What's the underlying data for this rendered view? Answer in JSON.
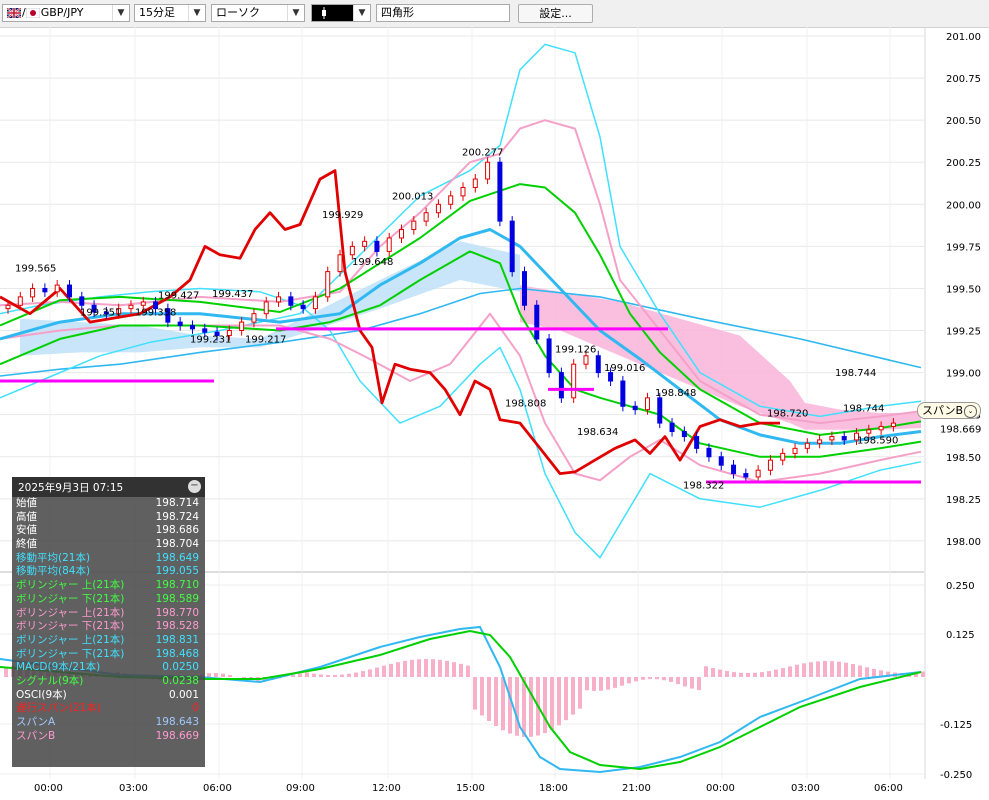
{
  "toolbar": {
    "symbol": "GBP/JPY",
    "symbol_prefix": "/",
    "timeframe": "15分足",
    "chart_type": "ローソク",
    "drawing_tool_icon": "candlestick-icon",
    "shape": "四角形",
    "settings_label": "設定..."
  },
  "colors": {
    "bull": "#e00000",
    "bear": "#0000e0",
    "ma21": "#00d000",
    "ma84": "#30b8f0",
    "bb_pink": "#f5a0c8",
    "bb_cyan": "#40e0ff",
    "chikou": "#e00000",
    "kumo": "#f9b4d8",
    "hline": "#ff00ff"
  },
  "price_axis": [
    "201.00",
    "200.75",
    "200.50",
    "200.25",
    "200.00",
    "199.75",
    "199.50",
    "199.25",
    "199.00",
    "198.75",
    "198.50",
    "198.25",
    "198.00"
  ],
  "macd_axis": [
    "0.250",
    "0.125",
    "-0.125",
    "-0.250"
  ],
  "current_price": "198.669",
  "spanb_tag": "スパンB",
  "time_axis": [
    "00:00",
    "03:00",
    "06:00",
    "09:00",
    "12:00",
    "15:00",
    "18:00",
    "21:00",
    "00:00",
    "03:00",
    "06:00"
  ],
  "annotations": [
    "199.565",
    "199.427",
    "199.437",
    "199.351",
    "199.358",
    "199.231",
    "199.217",
    "199.929",
    "199.648",
    "200.013",
    "200.277",
    "199.126",
    "199.016",
    "198.808",
    "198.848",
    "198.634",
    "198.322",
    "198.720",
    "198.744",
    "198.744",
    "198.590"
  ],
  "info_panel": {
    "datetime": "2025年9月3日  07:15",
    "rows": [
      {
        "label": "始値",
        "value": "198.714",
        "color": "#ffffff"
      },
      {
        "label": "高値",
        "value": "198.724",
        "color": "#ffffff"
      },
      {
        "label": "安値",
        "value": "198.686",
        "color": "#ffffff"
      },
      {
        "label": "終値",
        "value": "198.704",
        "color": "#ffffff"
      },
      {
        "label": "移動平均(21本)",
        "value": "198.649",
        "color": "#40e0ff"
      },
      {
        "label": "移動平均(84本)",
        "value": "199.055",
        "color": "#40e0ff"
      },
      {
        "label": "ボリンジャー 上(21本)",
        "value": "198.710",
        "color": "#40ff40"
      },
      {
        "label": "ボリンジャー 下(21本)",
        "value": "198.589",
        "color": "#40ff40"
      },
      {
        "label": "ボリンジャー 上(21本)",
        "value": "198.770",
        "color": "#ff9ad0"
      },
      {
        "label": "ボリンジャー 下(21本)",
        "value": "198.528",
        "color": "#ff9ad0"
      },
      {
        "label": "ボリンジャー 上(21本)",
        "value": "198.831",
        "color": "#40e0ff"
      },
      {
        "label": "ボリンジャー 下(21本)",
        "value": "198.468",
        "color": "#40e0ff"
      },
      {
        "label": "MACD(9本/21本)",
        "value": "0.0250",
        "color": "#40e0ff"
      },
      {
        "label": "シグナル(9本)",
        "value": "0.0238",
        "color": "#40ff40"
      },
      {
        "label": "OSCI(9本)",
        "value": "0.001",
        "color": "#ffffff"
      },
      {
        "label": "遅行スパン(21本)",
        "value": "0",
        "color": "#ff2020"
      },
      {
        "label": "スパンA",
        "value": "198.643",
        "color": "#a0c8ff"
      },
      {
        "label": "スパンB",
        "value": "198.669",
        "color": "#ff9ad0"
      }
    ]
  }
}
